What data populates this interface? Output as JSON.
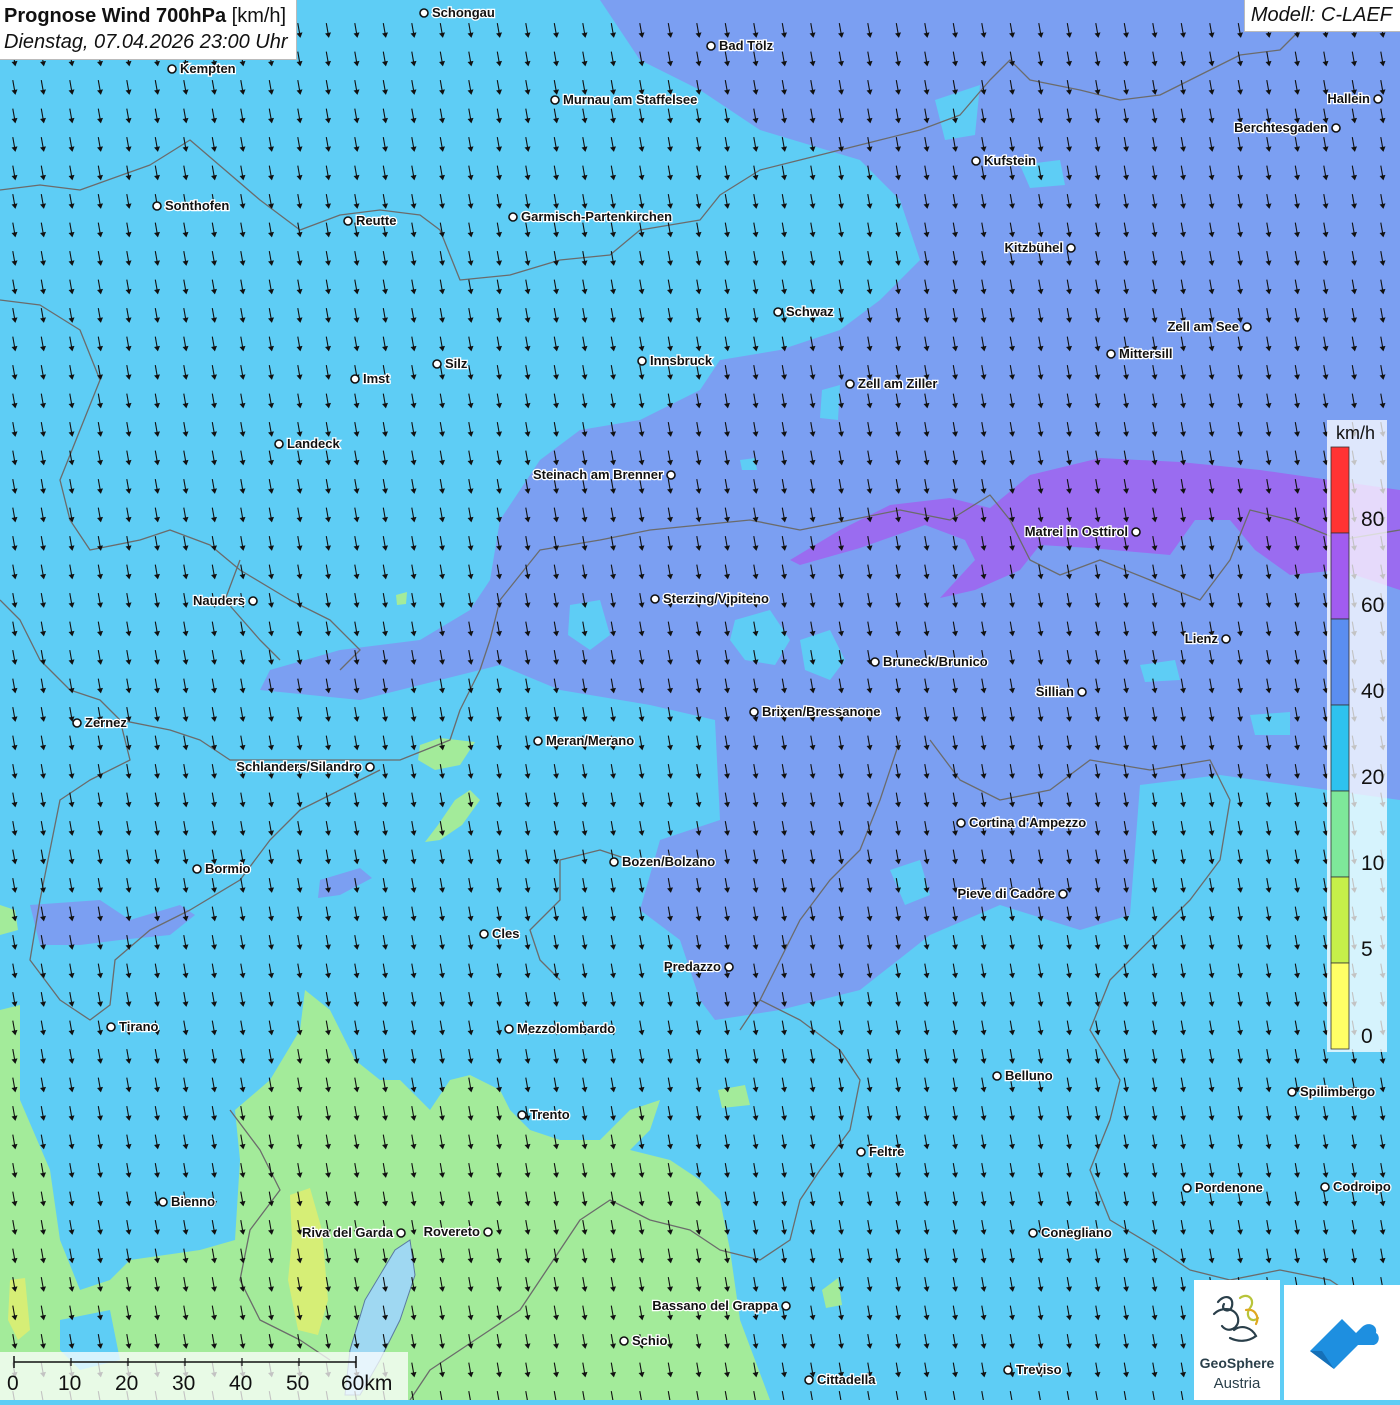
{
  "header": {
    "title_bold": "Prognose Wind 700hPa",
    "title_unit": "[km/h]",
    "datetime": "Dienstag, 07.04.2026 23:00 Uhr",
    "model": "Modell: C-LAEF"
  },
  "legend": {
    "unit": "km/h",
    "labels": [
      "80",
      "60",
      "40",
      "20",
      "10",
      "5",
      "0"
    ],
    "colors": [
      "#ff3333",
      "#a15cf0",
      "#5b8ef0",
      "#2ec2ee",
      "#7ee89a",
      "#c6f04a",
      "#ffff66"
    ]
  },
  "scale": {
    "labels": [
      "0",
      "10",
      "20",
      "30",
      "40",
      "50",
      "60km"
    ]
  },
  "colors": {
    "cyan": "#5ecdf5",
    "blue": "#7b9ff2",
    "violet": "#9a6cf0",
    "green": "#a3eb9a",
    "arrow": "#111111",
    "border": "#6b6b6b"
  },
  "wind": {
    "direction": "south-southeast",
    "arrow_icon": "wind-arrow-icon"
  },
  "cities": [
    {
      "name": "Schongau"
    },
    {
      "name": "Bad Tölz"
    },
    {
      "name": "Kempten"
    },
    {
      "name": "Murnau am Staffelsee"
    },
    {
      "name": "Hallein"
    },
    {
      "name": "Berchtesgaden"
    },
    {
      "name": "Kufstein"
    },
    {
      "name": "Sonthofen"
    },
    {
      "name": "Reutte"
    },
    {
      "name": "Garmisch-Partenkirchen"
    },
    {
      "name": "Kitzbühel"
    },
    {
      "name": "Schwaz"
    },
    {
      "name": "Zell am See"
    },
    {
      "name": "Mittersill"
    },
    {
      "name": "Innsbruck"
    },
    {
      "name": "Silz"
    },
    {
      "name": "Imst"
    },
    {
      "name": "Zell am Ziller"
    },
    {
      "name": "Landeck"
    },
    {
      "name": "Steinach am Brenner"
    },
    {
      "name": "Matrei in Osttirol"
    },
    {
      "name": "Nauders"
    },
    {
      "name": "Sterzing/Vipiteno"
    },
    {
      "name": "Lienz"
    },
    {
      "name": "Bruneck/Brunico"
    },
    {
      "name": "Sillian"
    },
    {
      "name": "Zernez"
    },
    {
      "name": "Brixen/Bressanone"
    },
    {
      "name": "Meran/Merano"
    },
    {
      "name": "Schlanders/Silandro"
    },
    {
      "name": "Cortina d'Ampezzo"
    },
    {
      "name": "Bozen/Bolzano"
    },
    {
      "name": "Bormio"
    },
    {
      "name": "Pieve di Cadore"
    },
    {
      "name": "Cles"
    },
    {
      "name": "Predazzo"
    },
    {
      "name": "Tirano"
    },
    {
      "name": "Mezzolombardo"
    },
    {
      "name": "Belluno"
    },
    {
      "name": "Spilimbergo"
    },
    {
      "name": "Trento"
    },
    {
      "name": "Feltre"
    },
    {
      "name": "Pordenone"
    },
    {
      "name": "Codroipo"
    },
    {
      "name": "Bienno"
    },
    {
      "name": "Riva del Garda"
    },
    {
      "name": "Rovereto"
    },
    {
      "name": "Conegliano"
    },
    {
      "name": "Bassano del Grappa"
    },
    {
      "name": "Schio"
    },
    {
      "name": "Treviso"
    },
    {
      "name": "Cittadella"
    }
  ],
  "logos": {
    "geosphere_line1": "GeoSphere",
    "geosphere_line2": "Austria"
  }
}
